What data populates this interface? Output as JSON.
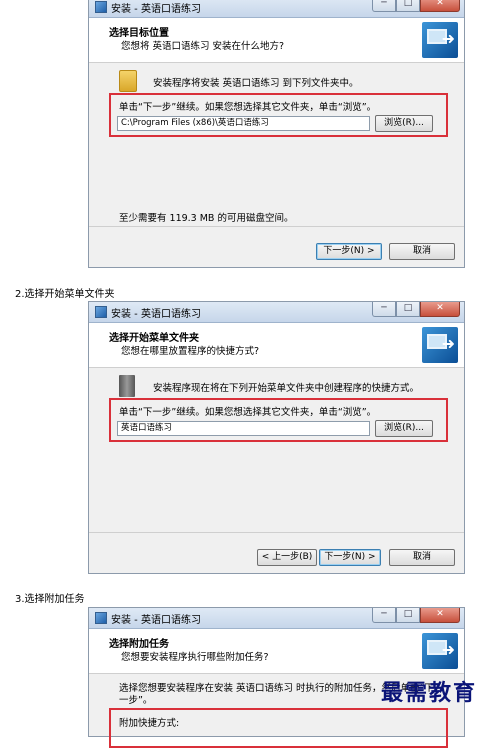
{
  "window_title": "安装 - 英语口语练习",
  "titlebar_buttons": {
    "minimize": "─",
    "maximize": "□",
    "close": "✕"
  },
  "step1": {
    "title": "选择目标位置",
    "subtitle": "您想将 英语口语练习 安装在什么地方?",
    "info": "安装程序将安装 英语口语练习 到下列文件夹中。",
    "prompt": "单击“下一步”继续。如果您想选择其它文件夹，单击“浏览”。",
    "path": "C:\\Program Files (x86)\\英语口语练习",
    "browse": "浏览(R)...",
    "space": "至少需要有 119.3 MB 的可用磁盘空间。",
    "next": "下一步(N) >",
    "cancel": "取消"
  },
  "label2": "2.选择开始菜单文件夹",
  "step2": {
    "title": "选择开始菜单文件夹",
    "subtitle": "您想在哪里放置程序的快捷方式?",
    "info": "安装程序现在将在下列开始菜单文件夹中创建程序的快捷方式。",
    "prompt": "单击“下一步”继续。如果您想选择其它文件夹，单击“浏览”。",
    "folder": "英语口语练习",
    "browse": "浏览(R)...",
    "back": "< 上一步(B)",
    "next": "下一步(N) >",
    "cancel": "取消"
  },
  "label3": "3.选择附加任务",
  "step3": {
    "title": "选择附加任务",
    "subtitle": "您想要安装程序执行哪些附加任务?",
    "info_line1": "选择您想要安装程序在安装 英语口语练习 时执行的附加任务，然后单击“下",
    "info_line2": "一步”。",
    "section": "附加快捷方式:"
  },
  "watermark": "最需教育"
}
